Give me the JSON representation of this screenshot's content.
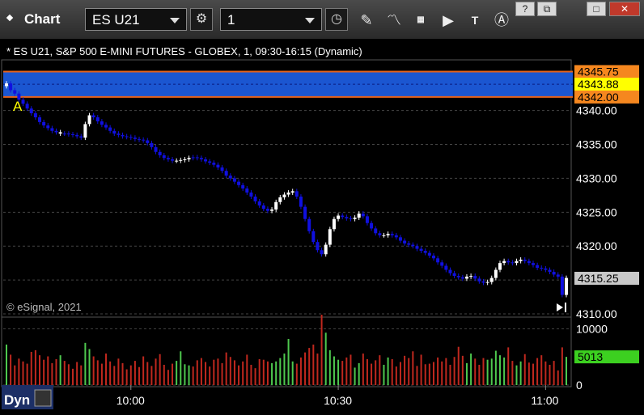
{
  "app": {
    "title": "Chart"
  },
  "toolbar": {
    "symbol": "ES U21",
    "interval": "1",
    "icons": [
      "settings-icon",
      "clock-icon",
      "pencil-icon",
      "study-icon",
      "get-icon",
      "play-icon",
      "text-icon",
      "alert-icon"
    ],
    "window_buttons": [
      "?",
      "⧉",
      "□",
      "✕"
    ]
  },
  "chart": {
    "header": "* ES U21, S&P 500 E-MINI FUTURES - GLOBEX, 1, 09:30-16:15 (Dynamic)",
    "watermark": "© eSignal, 2021",
    "marker_label": "A",
    "bottom_mode": "Dyn"
  },
  "colors": {
    "up_candle": "#ffffff",
    "down_candle": "#1010e0",
    "volume_up": "#4ec94e",
    "volume_down": "#c0281e",
    "band_fill": "#1e5fe8",
    "band_edge": "#e8631a",
    "price_tag_orange": "#f5871f",
    "price_tag_yellow": "#ffff00",
    "price_tag_gray": "#c8c8c8",
    "volume_tag_green": "#3cd020"
  },
  "chart_data": [
    {
      "type": "candlestick",
      "ylim": [
        4310,
        4347
      ],
      "yticks": [
        "4340.00",
        "4335.00",
        "4330.00",
        "4325.00",
        "4320.00",
        "4315.00",
        "4310.00"
      ],
      "xticks": [
        "10:00",
        "10:30",
        "11:00"
      ],
      "band": {
        "upper": 4345.75,
        "mid": 4343.88,
        "lower": 4342.0
      },
      "price_tags": [
        "4345.75",
        "4343.88",
        "4342.00",
        "4315.25"
      ],
      "last_price": 4315.25,
      "close_series": [
        4344,
        4343,
        4342.5,
        4341.6,
        4341,
        4340.3,
        4339.6,
        4339,
        4338.3,
        4337.8,
        4337.4,
        4337,
        4336.8,
        4336.6,
        4336.6,
        4336.5,
        4336.4,
        4336.2,
        4336,
        4338,
        4339.3,
        4339,
        4338.4,
        4337.9,
        4337.5,
        4337,
        4336.6,
        4336.4,
        4336.2,
        4336.1,
        4336,
        4335.8,
        4335.7,
        4335.6,
        4335.2,
        4334.6,
        4333.9,
        4333.4,
        4333,
        4332.8,
        4332.6,
        4332.6,
        4332.7,
        4332.8,
        4333,
        4333.1,
        4333,
        4332.8,
        4332.5,
        4332.3,
        4332,
        4331.6,
        4331.1,
        4330.4,
        4330,
        4329.5,
        4329,
        4328.5,
        4327.9,
        4327.3,
        4326.6,
        4326,
        4325.5,
        4325.2,
        4325.4,
        4326.5,
        4327.2,
        4327.6,
        4327.9,
        4328.1,
        4327.3,
        4325.8,
        4324,
        4322.2,
        4320.6,
        4319.4,
        4318.8,
        4320.2,
        4322.5,
        4324,
        4324.5,
        4324.3,
        4324.1,
        4324,
        4324.2,
        4324.8,
        4324.4,
        4323.4,
        4322.6,
        4321.9,
        4321.6,
        4321.6,
        4321.8,
        4321.6,
        4321.3,
        4320.8,
        4320.4,
        4320.2,
        4320,
        4319.6,
        4319.3,
        4319,
        4318.6,
        4318.2,
        4317.6,
        4317.1,
        4316.5,
        4316,
        4315.6,
        4315.4,
        4315.2,
        4315.5,
        4315.6,
        4315.2,
        4314.8,
        4314.6,
        4314.7,
        4315.3,
        4316.5,
        4317.5,
        4317.8,
        4317.6,
        4317.5,
        4317.8,
        4318,
        4317.8,
        4317.5,
        4317.2,
        4316.8,
        4316.7,
        4316.5,
        4316.2,
        4315.8,
        4315.5,
        4312.8,
        4315.3
      ],
      "candle_colors": [
        "up",
        "down",
        "down",
        "down",
        "down",
        "down",
        "down",
        "down",
        "down",
        "down",
        "down",
        "down",
        "down",
        "up",
        "down",
        "down",
        "down",
        "down",
        "down",
        "up",
        "up",
        "down",
        "down",
        "down",
        "down",
        "down",
        "down",
        "down",
        "down",
        "down",
        "down",
        "down",
        "down",
        "down",
        "down",
        "down",
        "down",
        "down",
        "down",
        "down",
        "down",
        "up",
        "up",
        "up",
        "up",
        "down",
        "down",
        "down",
        "down",
        "down",
        "down",
        "down",
        "down",
        "down",
        "down",
        "down",
        "down",
        "down",
        "down",
        "down",
        "down",
        "down",
        "down",
        "down",
        "up",
        "up",
        "up",
        "up",
        "up",
        "up",
        "down",
        "down",
        "down",
        "down",
        "down",
        "down",
        "down",
        "up",
        "up",
        "up",
        "up",
        "down",
        "down",
        "down",
        "up",
        "up",
        "down",
        "down",
        "down",
        "down",
        "down",
        "up",
        "up",
        "down",
        "down",
        "down",
        "down",
        "down",
        "down",
        "down",
        "down",
        "down",
        "down",
        "down",
        "down",
        "down",
        "down",
        "down",
        "down",
        "down",
        "down",
        "up",
        "up",
        "down",
        "down",
        "down",
        "up",
        "up",
        "up",
        "up",
        "up",
        "down",
        "down",
        "up",
        "up",
        "down",
        "down",
        "down",
        "down",
        "down",
        "down",
        "down",
        "down",
        "down",
        "down",
        "up"
      ],
      "bars_per_30min": 50,
      "first_bar_time": "09:30"
    },
    {
      "type": "bar",
      "name": "volume",
      "ylim": [
        0,
        11500
      ],
      "yticks": [
        "10000",
        "0"
      ],
      "volume_tag": "5013",
      "last_volume": 5013,
      "values": [
        7200,
        5400,
        3500,
        4700,
        4200,
        3800,
        5900,
        6200,
        5300,
        4500,
        5100,
        3900,
        4600,
        5300,
        4300,
        3700,
        2900,
        4100,
        3500,
        7500,
        6400,
        5100,
        4400,
        3800,
        5600,
        4200,
        3400,
        4700,
        3900,
        2800,
        3500,
        4300,
        3200,
        5100,
        4100,
        3400,
        4700,
        5500,
        3600,
        2700,
        3800,
        4300,
        6000,
        3700,
        3500,
        3300,
        4400,
        4800,
        4100,
        3300,
        4500,
        4700,
        3900,
        5800,
        5000,
        4400,
        3500,
        4200,
        5400,
        3600,
        3000,
        4600,
        4500,
        4200,
        3900,
        4200,
        4800,
        5600,
        8200,
        4200,
        3800,
        4900,
        5800,
        6600,
        7200,
        5600,
        12500,
        9300,
        6200,
        5100,
        4500,
        4300,
        4900,
        5400,
        3100,
        3900,
        5600,
        4600,
        3800,
        4400,
        5300,
        3600,
        4900,
        4600,
        3300,
        4100,
        5200,
        4800,
        6000,
        3400,
        5400,
        3700,
        3800,
        4100,
        4900,
        4200,
        4800,
        3600,
        5000,
        6800,
        5200,
        3900,
        5600,
        4700,
        3600,
        4800,
        4500,
        4700,
        6100,
        5300,
        4900,
        6700,
        4300,
        3500,
        4200,
        5500,
        4000,
        3800,
        4800,
        5300,
        4200,
        3600,
        4300,
        2600,
        6700,
        5013
      ]
    }
  ]
}
